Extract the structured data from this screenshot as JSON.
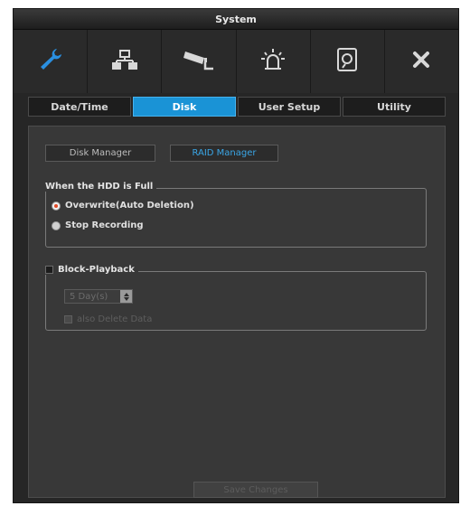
{
  "window": {
    "title": "System"
  },
  "toolbar": {
    "icons": [
      "wrench-icon",
      "network-icon",
      "camera-icon",
      "alarm-icon",
      "disk-icon",
      "close-icon"
    ],
    "accent": "#1a93d6"
  },
  "tabs": [
    {
      "label": "Date/Time",
      "active": false
    },
    {
      "label": "Disk",
      "active": true
    },
    {
      "label": "User Setup",
      "active": false
    },
    {
      "label": "Utility",
      "active": false
    }
  ],
  "subtabs": [
    {
      "label": "Disk Manager",
      "selected": false
    },
    {
      "label": "RAID Manager",
      "selected": true
    }
  ],
  "hdd_full": {
    "title": "When the HDD is Full",
    "options": [
      {
        "label": "Overwrite(Auto Deletion)",
        "selected": true
      },
      {
        "label": "Stop Recording",
        "selected": false
      }
    ]
  },
  "block_playback": {
    "title": "Block-Playback",
    "checked": false,
    "duration_value": "5 Day(s)",
    "delete_label": "also Delete Data",
    "delete_checked": false
  },
  "footer": {
    "save_label": "Save Changes"
  }
}
